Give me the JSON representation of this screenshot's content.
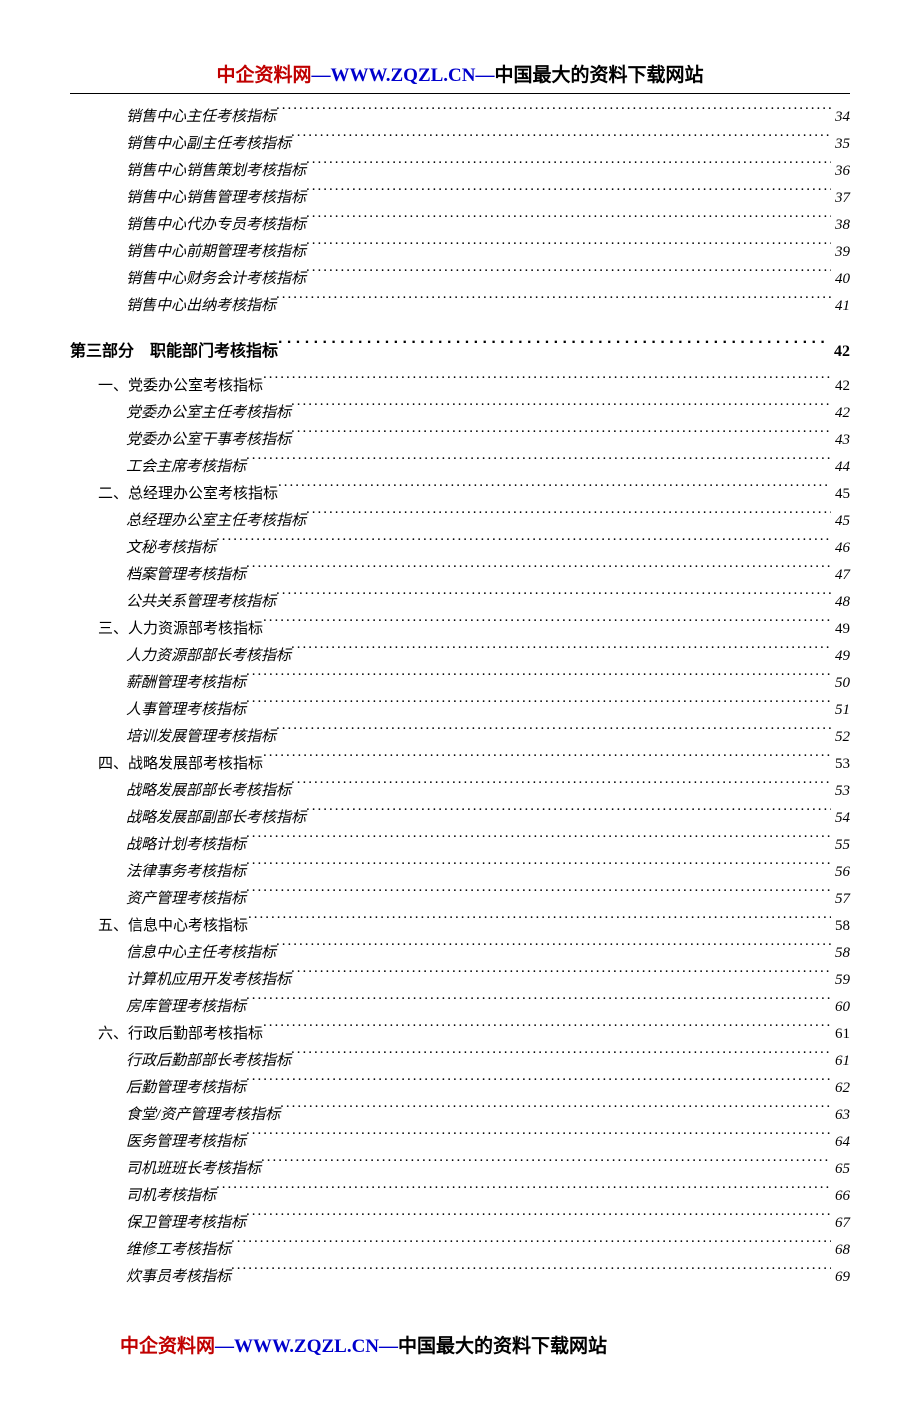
{
  "header": {
    "brand": "中企资料网",
    "sep": "—",
    "url": "WWW.ZQZL.CN",
    "tagline": "中国最大的资料下载网站"
  },
  "footer": {
    "brand": "中企资料网",
    "sep": "—",
    "url": "WWW.ZQZL.CN",
    "tagline": "中国最大的资料下载网站"
  },
  "toc": [
    {
      "level": "item",
      "label": "销售中心主任考核指标",
      "page": "34"
    },
    {
      "level": "item",
      "label": "销售中心副主任考核指标",
      "page": "35"
    },
    {
      "level": "item",
      "label": "销售中心销售策划考核指标",
      "page": "36"
    },
    {
      "level": "item",
      "label": "销售中心销售管理考核指标",
      "page": "37"
    },
    {
      "level": "item",
      "label": "销售中心代办专员考核指标",
      "page": "38"
    },
    {
      "level": "item",
      "label": "销售中心前期管理考核指标",
      "page": "39"
    },
    {
      "level": "item",
      "label": "销售中心财务会计考核指标",
      "page": "40"
    },
    {
      "level": "item",
      "label": "销售中心出纳考核指标",
      "page": "41"
    },
    {
      "level": "part",
      "label": "第三部分　职能部门考核指标",
      "page": "42"
    },
    {
      "level": "section",
      "label": "一、党委办公室考核指标",
      "page": "42"
    },
    {
      "level": "item",
      "label": "党委办公室主任考核指标",
      "page": "42"
    },
    {
      "level": "item",
      "label": "党委办公室干事考核指标",
      "page": "43"
    },
    {
      "level": "item",
      "label": "工会主席考核指标",
      "page": "44"
    },
    {
      "level": "section",
      "label": "二、总经理办公室考核指标",
      "page": "45"
    },
    {
      "level": "item",
      "label": "总经理办公室主任考核指标",
      "page": "45"
    },
    {
      "level": "item",
      "label": "文秘考核指标",
      "page": "46"
    },
    {
      "level": "item",
      "label": "档案管理考核指标",
      "page": "47"
    },
    {
      "level": "item",
      "label": "公共关系管理考核指标",
      "page": "48"
    },
    {
      "level": "section",
      "label": "三、人力资源部考核指标",
      "page": "49"
    },
    {
      "level": "item",
      "label": "人力资源部部长考核指标",
      "page": "49"
    },
    {
      "level": "item",
      "label": "薪酬管理考核指标",
      "page": "50"
    },
    {
      "level": "item",
      "label": "人事管理考核指标",
      "page": "51"
    },
    {
      "level": "item",
      "label": "培训发展管理考核指标",
      "page": "52"
    },
    {
      "level": "section",
      "label": "四、战略发展部考核指标",
      "page": "53"
    },
    {
      "level": "item",
      "label": "战略发展部部长考核指标",
      "page": "53"
    },
    {
      "level": "item",
      "label": "战略发展部副部长考核指标",
      "page": "54"
    },
    {
      "level": "item",
      "label": "战略计划考核指标",
      "page": "55"
    },
    {
      "level": "item",
      "label": "法律事务考核指标",
      "page": "56"
    },
    {
      "level": "item",
      "label": "资产管理考核指标",
      "page": "57"
    },
    {
      "level": "section",
      "label": "五、信息中心考核指标",
      "page": "58"
    },
    {
      "level": "item",
      "label": "信息中心主任考核指标",
      "page": "58"
    },
    {
      "level": "item",
      "label": "计算机应用开发考核指标",
      "page": "59"
    },
    {
      "level": "item",
      "label": "房库管理考核指标",
      "page": "60"
    },
    {
      "level": "section",
      "label": "六、行政后勤部考核指标",
      "page": "61"
    },
    {
      "level": "item",
      "label": "行政后勤部部长考核指标",
      "page": "61"
    },
    {
      "level": "item",
      "label": "后勤管理考核指标",
      "page": "62"
    },
    {
      "level": "item",
      "label": "食堂/资产管理考核指标",
      "page": "63"
    },
    {
      "level": "item",
      "label": "医务管理考核指标",
      "page": "64"
    },
    {
      "level": "item",
      "label": "司机班班长考核指标",
      "page": "65"
    },
    {
      "level": "item",
      "label": "司机考核指标",
      "page": "66"
    },
    {
      "level": "item",
      "label": "保卫管理考核指标",
      "page": "67"
    },
    {
      "level": "item",
      "label": "维修工考核指标",
      "page": "68"
    },
    {
      "level": "item",
      "label": "炊事员考核指标",
      "page": "69"
    }
  ]
}
